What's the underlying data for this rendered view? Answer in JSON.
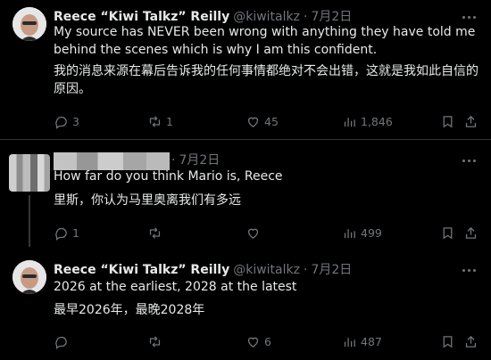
{
  "tweets": [
    {
      "author": {
        "name": "Reece “Kiwi Talkz” Reilly",
        "handle": "@kiwitalkz",
        "separator": "·",
        "date": "7月2日"
      },
      "text_en": "My source has NEVER been wrong with anything they have told me behind the scenes which is why I am this confident.",
      "text_zh": "我的消息来源在幕后告诉我的任何事情都绝对不会出错，这就是我如此自信的原因。",
      "stats": {
        "replies": "3",
        "reposts": "1",
        "likes": "45",
        "views": "1,846"
      }
    },
    {
      "author": {
        "name": "",
        "handle": "",
        "separator": "·",
        "date": "7月2日"
      },
      "text_en": "How far do you think Mario is, Reece",
      "text_zh": "里斯，你认为马里奥离我们有多远",
      "stats": {
        "replies": "1",
        "reposts": "",
        "likes": "",
        "views": "499"
      }
    },
    {
      "author": {
        "name": "Reece “Kiwi Talkz” Reilly",
        "handle": "@kiwitalkz",
        "separator": "·",
        "date": "7月2日"
      },
      "text_en": "2026 at the earliest, 2028 at the latest",
      "text_zh": "最早2026年，最晚2028年",
      "stats": {
        "replies": "",
        "reposts": "",
        "likes": "6",
        "views": "487"
      }
    }
  ],
  "colors": {
    "background": "#000000",
    "text": "#e7e9ea",
    "muted": "#71767b",
    "divider": "#2f3336"
  },
  "icons": [
    "reply-icon",
    "repost-icon",
    "like-icon",
    "views-icon",
    "bookmark-icon",
    "share-icon",
    "more-icon"
  ]
}
